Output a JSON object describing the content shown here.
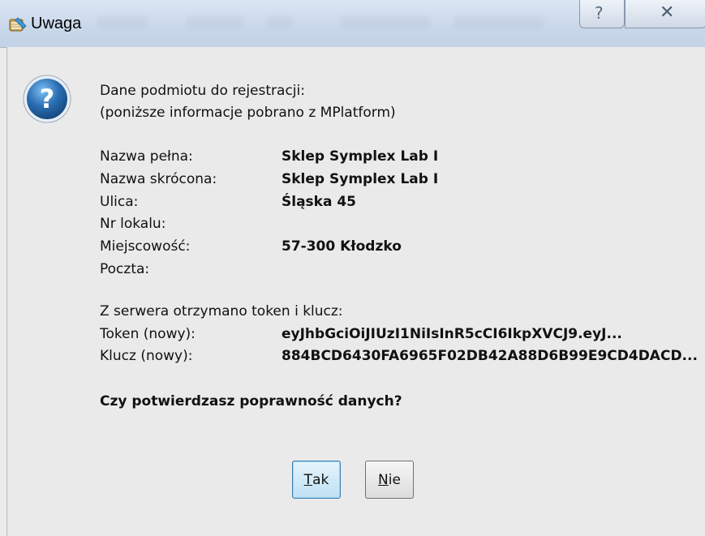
{
  "window": {
    "title": "Uwaga",
    "help_glyph": "?",
    "close_glyph": "✕"
  },
  "message": {
    "intro_line1": "Dane podmiotu do rejestracji:",
    "intro_line2": "(poniższe informacje pobrano z MPlatform)",
    "fields": [
      {
        "label": "Nazwa pełna:",
        "value": "Sklep Symplex Lab I"
      },
      {
        "label": "Nazwa skrócona:",
        "value": "Sklep Symplex Lab I"
      },
      {
        "label": "Ulica:",
        "value": "Śląska 45"
      },
      {
        "label": "Nr lokalu:",
        "value": ""
      },
      {
        "label": "Miejscowość:",
        "value": "57-300 Kłodzko"
      },
      {
        "label": "Poczta:",
        "value": ""
      }
    ],
    "server_line": "Z serwera otrzymano token i klucz:",
    "token_label": "Token (nowy):",
    "token_value": "eyJhbGciOiJIUzI1NiIsInR5cCI6IkpXVCJ9.eyJ...",
    "key_label": "Klucz (nowy):",
    "key_value": "884BCD6430FA6965F02DB42A88D6B99E9CD4DACD...",
    "question": "Czy potwierdzasz poprawność danych?"
  },
  "buttons": {
    "yes_mnemonic": "T",
    "yes_rest": "ak",
    "no_mnemonic": "N",
    "no_rest": "ie"
  },
  "icons": {
    "title": "app-calendar-icon",
    "question": "question-icon"
  },
  "colors": {
    "titlebar": "#c9d7ea",
    "dialog_bg": "#eaeaea",
    "question_icon": "#2a6fb3",
    "default_button_border": "#3c7fb1"
  }
}
